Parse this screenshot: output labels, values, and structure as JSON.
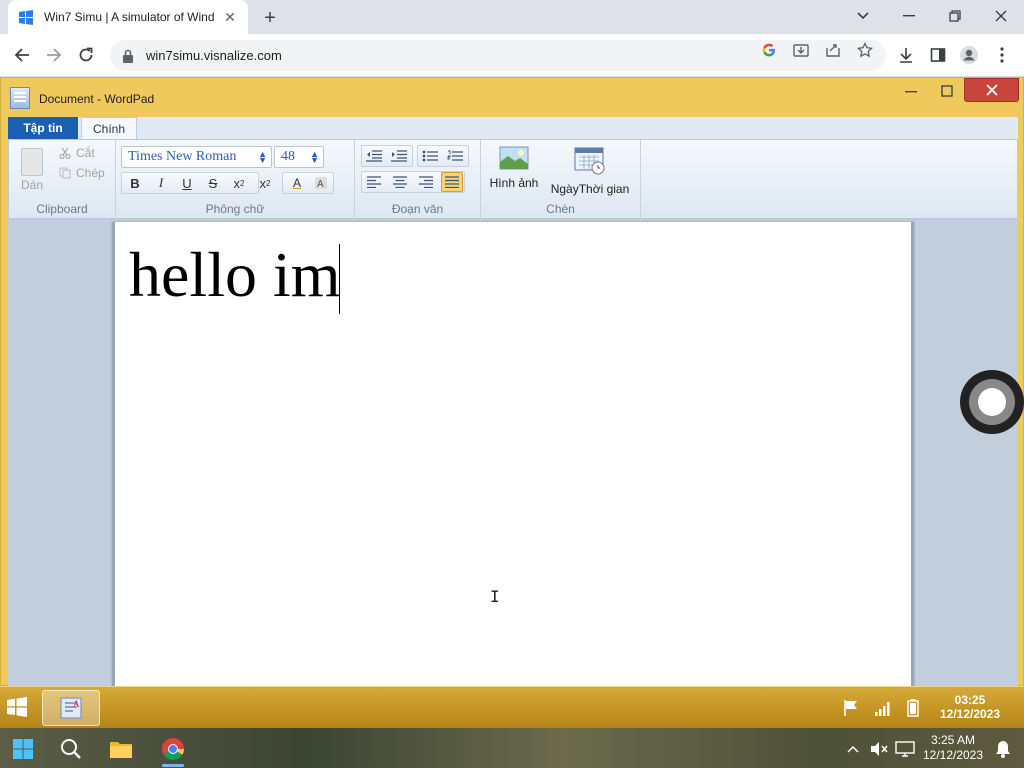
{
  "browser": {
    "tab_title": "Win7 Simu | A simulator of Wind",
    "url": "win7simu.visnalize.com"
  },
  "wordpad": {
    "window_title": "Document - WordPad",
    "tabs": {
      "file": "Tập tin",
      "home": "Chính"
    },
    "clipboard": {
      "paste": "Dán",
      "cut": "Cắt",
      "copy": "Chép",
      "group": "Clipboard"
    },
    "font": {
      "family": "Times New Roman",
      "size": "48",
      "group": "Phông chữ"
    },
    "paragraph": {
      "group": "Đoạn văn"
    },
    "insert": {
      "picture": "Hình ảnh",
      "datetime": "NgàyThời gian",
      "group": "Chèn"
    },
    "document_text": "hello im"
  },
  "sim_taskbar": {
    "time": "03:25",
    "date": "12/12/2023"
  },
  "host_taskbar": {
    "time": "3:25 AM",
    "date": "12/12/2023"
  }
}
